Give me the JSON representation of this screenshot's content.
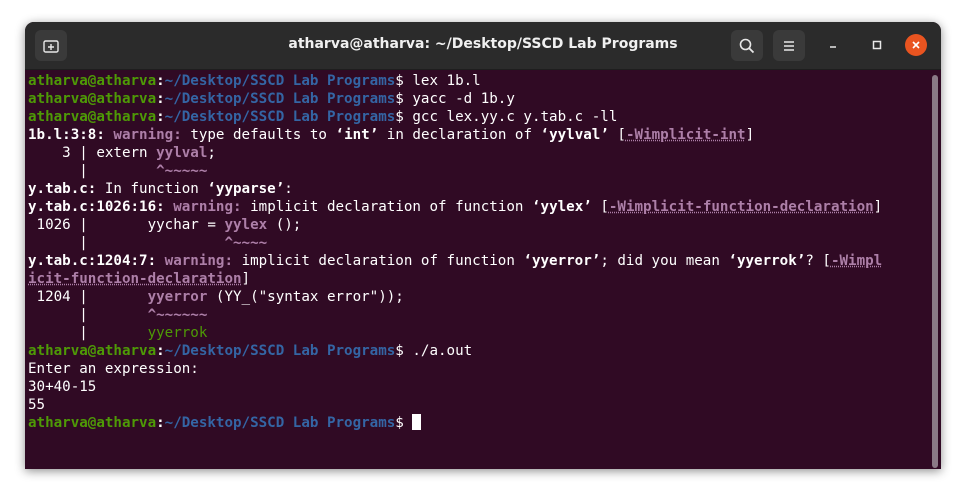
{
  "window": {
    "title": "atharva@atharva: ~/Desktop/SSCD Lab Programs"
  },
  "icons": {
    "new_tab": "new-tab-icon",
    "search": "search-icon",
    "menu": "hamburger-menu-icon",
    "minimize": "minimize-icon",
    "maximize": "maximize-icon",
    "close": "close-icon"
  },
  "colors": {
    "terminal_bg": "#300a24",
    "prompt_user": "#4e9a06",
    "prompt_path": "#3465a4",
    "warning": "#ad7fa8",
    "close_button": "#e95420"
  },
  "terminal": {
    "prompt_user": "atharva@atharva",
    "prompt_path": "~/Desktop/SSCD Lab Programs",
    "cmd1": "lex 1b.l",
    "cmd2": "yacc -d 1b.y",
    "cmd3": "gcc lex.yy.c y.tab.c -ll",
    "w1_loc": "1b.l:3:8:",
    "w_label": "warning:",
    "w1_text_a": "type defaults to ",
    "w1_tok_a": "‘int’",
    "w1_text_b": " in declaration of ",
    "w1_tok_b": "‘yylval’",
    "w1_flag": "-Wimplicit-int",
    "src1_pre": "    3 | extern ",
    "src1_hl": "yylval",
    "src1_post": ";",
    "caret1_pre": "      |        ",
    "caret1": "^~~~~~",
    "infn_file": "y.tab.c:",
    "infn_text": " In function ",
    "infn_name": "‘yyparse’",
    "infn_end": ":",
    "w2_loc": "y.tab.c:1026:16:",
    "w2_text_a": "implicit declaration of function ",
    "w2_tok": "‘yylex’",
    "w2_flag": "-Wimplicit-function-declaration",
    "src2_pre": " 1026 |       yychar = ",
    "src2_hl": "yylex",
    "src2_post": " ();",
    "caret2_pre": "      |                ",
    "caret2": "^~~~~",
    "w3_loc": "y.tab.c:1204:7:",
    "w3_text_a": "implicit declaration of function ",
    "w3_tok_a": "‘yyerror’",
    "w3_text_b": "; did you mean ",
    "w3_tok_b": "‘yyerrok’",
    "w3_text_c": "? ",
    "w3_flag_a": "-Wimpl",
    "w3_flag_b": "icit-function-declaration",
    "src3_pre": " 1204 |       ",
    "src3_hl": "yyerror",
    "src3_post": " (YY_(\"syntax error\"));",
    "caret3_pre": "      |       ",
    "caret3": "^~~~~~~",
    "sugg_pre": "      |       ",
    "sugg": "yyerrok",
    "cmd4": "./a.out",
    "out1": "Enter an expression:",
    "out2": "30+40-15",
    "out3": "55"
  }
}
